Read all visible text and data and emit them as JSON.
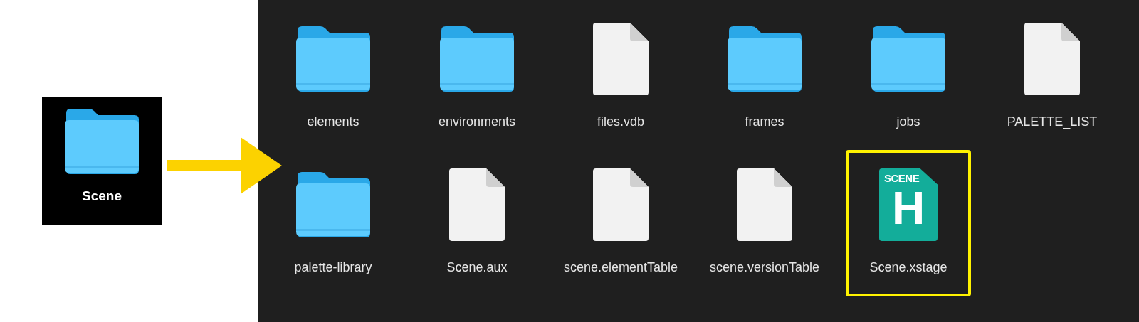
{
  "source_folder": {
    "name": "Scene",
    "kind": "folder"
  },
  "contents": [
    {
      "name": "elements",
      "kind": "folder",
      "selected": false
    },
    {
      "name": "environments",
      "kind": "folder",
      "selected": false
    },
    {
      "name": "files.vdb",
      "kind": "file",
      "selected": false
    },
    {
      "name": "frames",
      "kind": "folder",
      "selected": false
    },
    {
      "name": "jobs",
      "kind": "folder",
      "selected": false
    },
    {
      "name": "PALETTE_LIST",
      "kind": "file",
      "selected": false
    },
    {
      "name": "palette-library",
      "kind": "folder",
      "selected": false
    },
    {
      "name": "Scene.aux",
      "kind": "file",
      "selected": false
    },
    {
      "name": "scene.elementTable",
      "kind": "file",
      "selected": false
    },
    {
      "name": "scene.versionTable",
      "kind": "file",
      "selected": false
    },
    {
      "name": "Scene.xstage",
      "kind": "app",
      "selected": true,
      "badge_text": "SCENE",
      "glyph": "H"
    }
  ]
}
